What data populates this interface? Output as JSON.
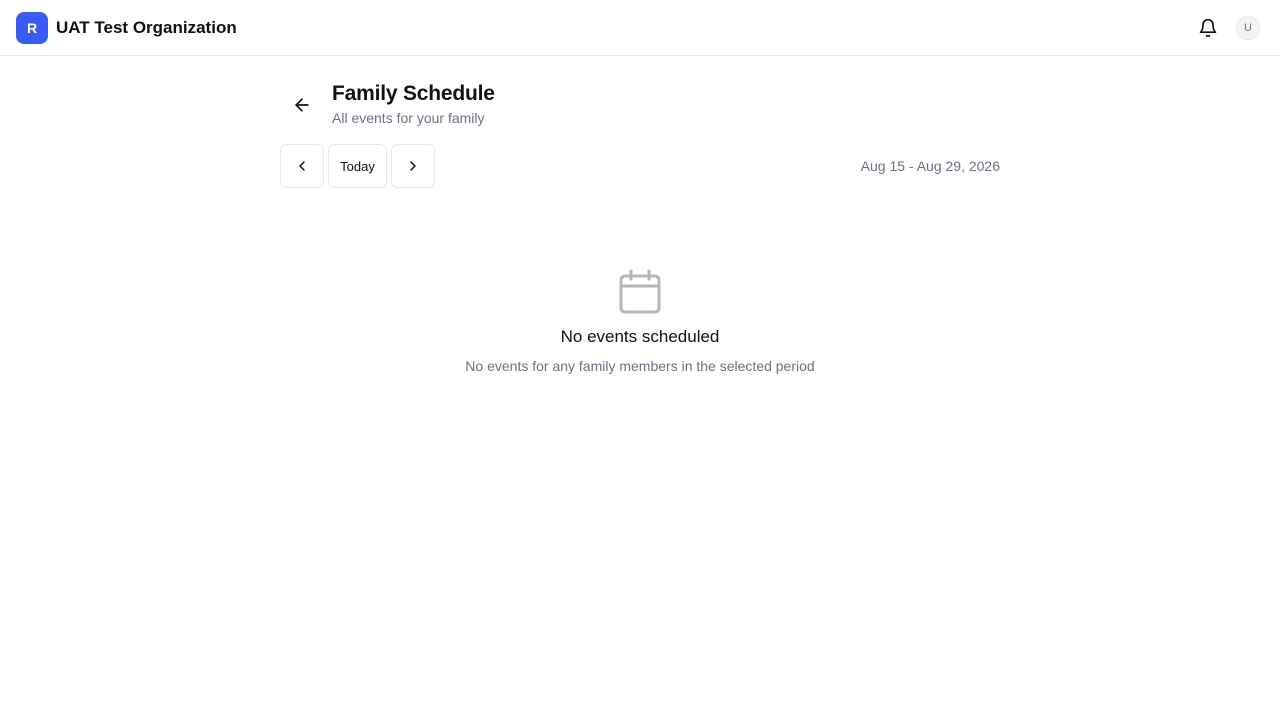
{
  "header": {
    "org_initial": "R",
    "org_name": "UAT Test Organization",
    "brand_color": "#3b5bf5",
    "notification_icon": "bell-icon",
    "user_initial": "U"
  },
  "page": {
    "back_icon": "arrow-left-icon",
    "title": "Family Schedule",
    "subtitle": "All events for your family"
  },
  "toolbar": {
    "prev_icon": "chevron-left-icon",
    "today_label": "Today",
    "next_icon": "chevron-right-icon",
    "date_range": "Aug 15 - Aug 29, 2026"
  },
  "empty_state": {
    "icon": "calendar-icon",
    "title": "No events scheduled",
    "description": "No events for any family members in the selected period"
  }
}
